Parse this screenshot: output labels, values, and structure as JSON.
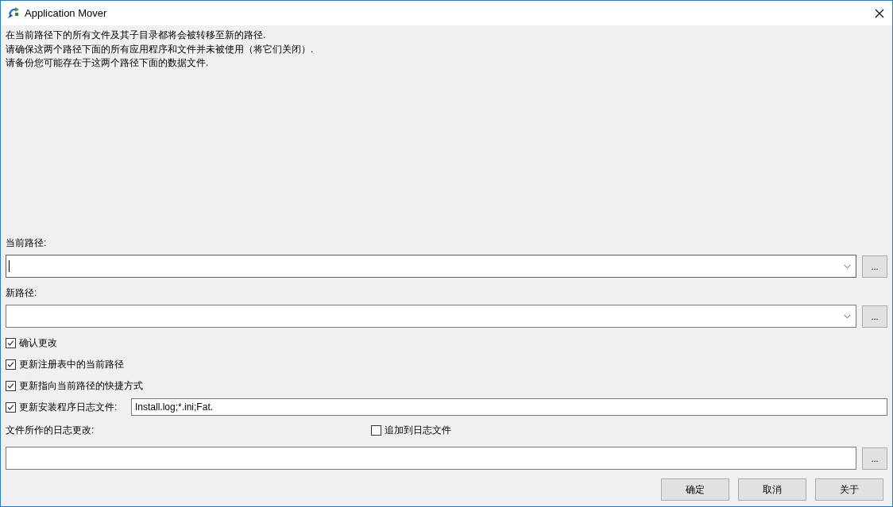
{
  "window": {
    "title": "Application Mover"
  },
  "intro": [
    "在当前路径下的所有文件及其子目录都将会被转移至新的路径.",
    "请确保这两个路径下面的所有应用程序和文件并未被使用（将它们关闭）.",
    "请备份您可能存在于这两个路径下面的数据文件."
  ],
  "paths": [
    {
      "label": "当前路径:",
      "focused": true,
      "browse": "..."
    },
    {
      "label": "新路径:",
      "focused": false,
      "browse": "..."
    }
  ],
  "options": [
    {
      "kind": "plain",
      "label": "确认更改",
      "checked": true
    },
    {
      "kind": "plain",
      "label": "更新注册表中的当前路径",
      "checked": true
    },
    {
      "kind": "plain",
      "label": "更新指向当前路径的快捷方式",
      "checked": true
    },
    {
      "kind": "with_field",
      "label": "更新安装程序日志文件:",
      "checked": true,
      "value": "Install.log;*.ini;Fat."
    }
  ],
  "log": {
    "label": "文件所作的日志更改:",
    "append": {
      "label": "追加到日志文件",
      "checked": false
    },
    "browse": "..."
  },
  "buttons": [
    "确定",
    "取消",
    "关于"
  ]
}
